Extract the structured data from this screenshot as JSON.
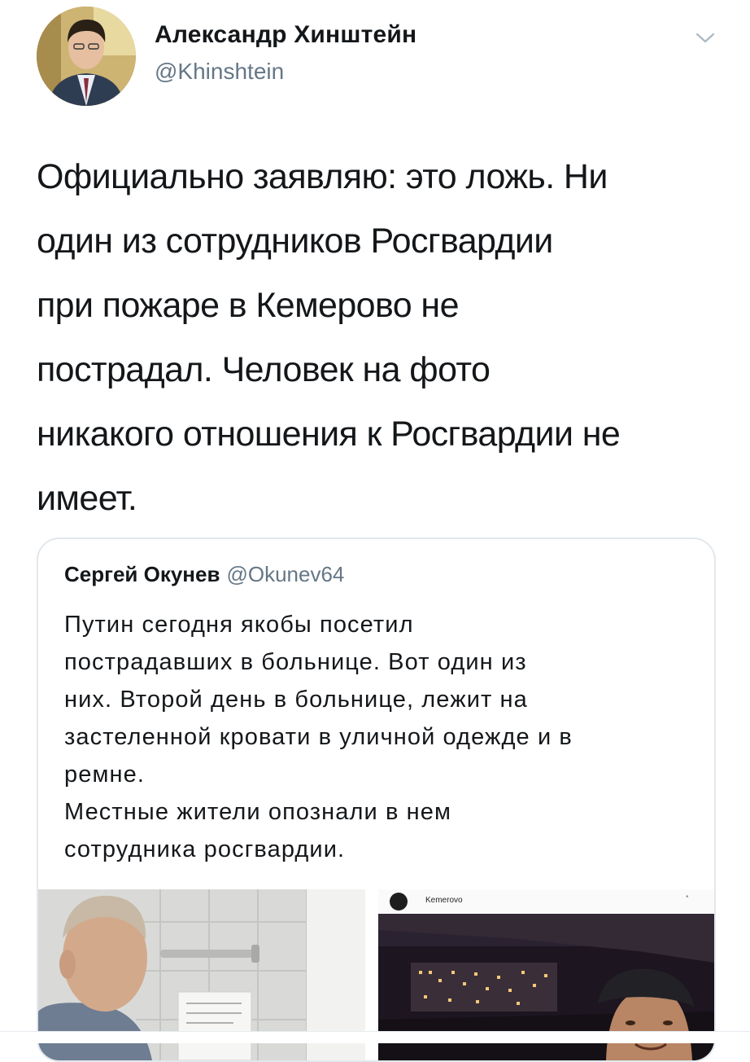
{
  "author": {
    "name": "Александр Хинштейн",
    "handle": "@Khinshtein",
    "avatar_icon": "user-avatar-photo"
  },
  "menu_icon": "chevron-down-icon",
  "tweet": {
    "lines": [
      "Официально заявляю: это ложь. Ни",
      "один из сотрудников Росгвардии",
      "при пожаре в Кемерово не",
      "пострадал. Человек на фото",
      "никакого отношения к Росгвардии не",
      "имеет."
    ]
  },
  "quoted": {
    "name": "Сергей Окунев",
    "handle": "@Okunev64",
    "lines": [
      "Путин сегодня якобы посетил",
      "пострадавших в больнице. Вот один из",
      "них. Второй день в больнице, лежит на",
      "застеленной кровати в уличной одежде и в",
      "ремне.",
      "Местные жители опознали в нем",
      "сотрудника росгвардии."
    ],
    "media": {
      "right_location": "Kemerovo",
      "right_menu": "•"
    }
  },
  "colors": {
    "text": "#14171a",
    "secondary": "#657786",
    "border": "#e1e8ed"
  }
}
